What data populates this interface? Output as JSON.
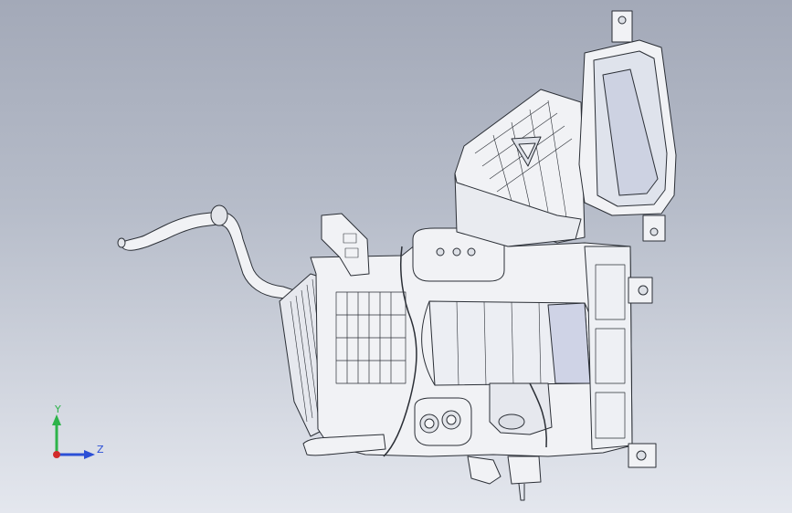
{
  "viewport": {
    "background_top": "#a3a9b8",
    "background_bottom": "#e4e7ee"
  },
  "model": {
    "icon": "hvac-assembly-wireframe",
    "line_color": "#2b2f36",
    "fill_color": "#f1f2f5",
    "accent_color": "#cfd3e6"
  },
  "triad": {
    "y_label": "Y",
    "z_label": "Z",
    "y_color": "#2db34a",
    "z_color": "#2b4fd6",
    "x_color": "#d12b2b"
  }
}
